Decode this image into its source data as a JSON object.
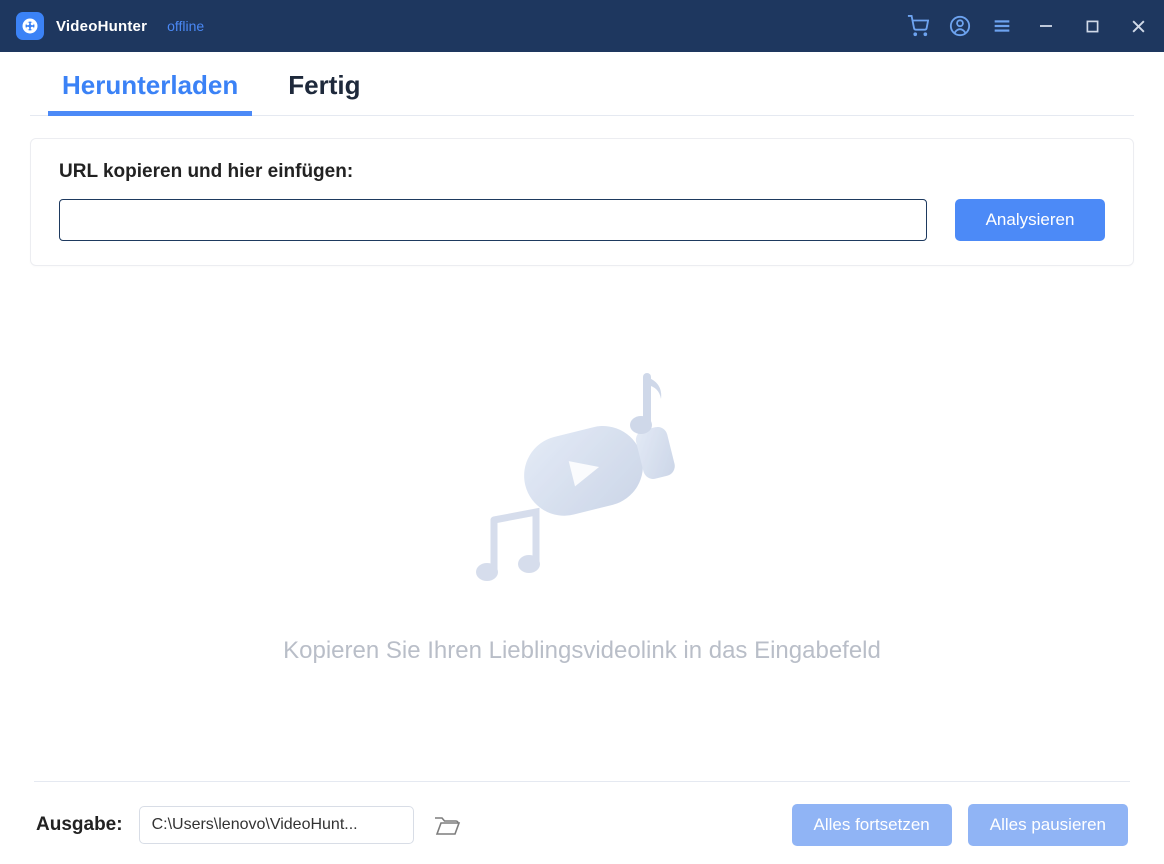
{
  "header": {
    "app_title": "VideoHunter",
    "status": "offline"
  },
  "tabs": {
    "download": "Herunterladen",
    "done": "Fertig"
  },
  "url_card": {
    "label": "URL kopieren und hier einfügen:",
    "input_value": "",
    "analyze_button": "Analysieren"
  },
  "empty_state": {
    "text": "Kopieren Sie Ihren Lieblingsvideolink in das Eingabefeld"
  },
  "footer": {
    "output_label": "Ausgabe:",
    "output_path": "C:\\Users\\lenovo\\VideoHunt...",
    "resume_all": "Alles fortsetzen",
    "pause_all": "Alles pausieren"
  }
}
